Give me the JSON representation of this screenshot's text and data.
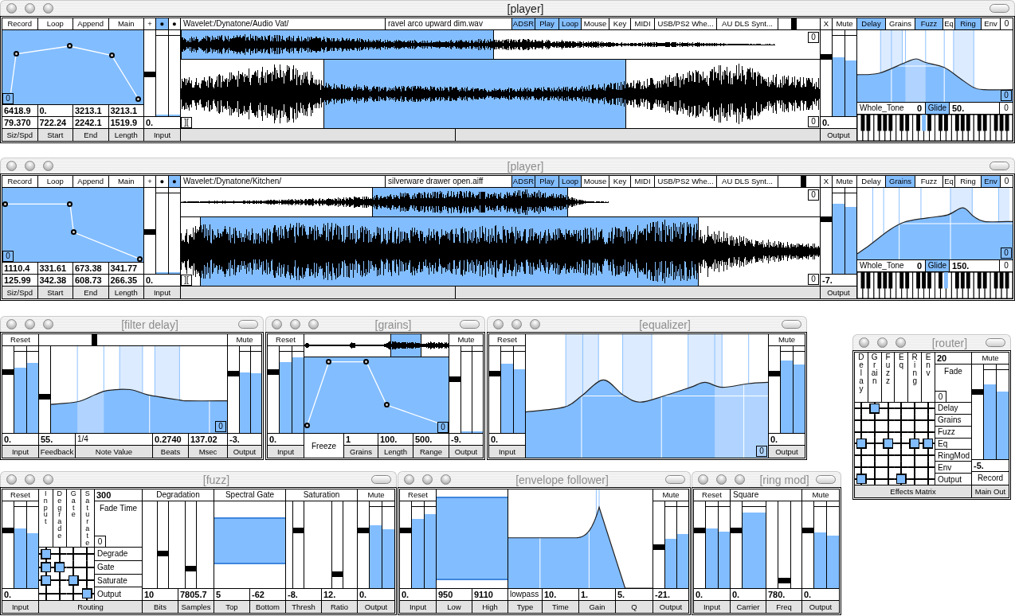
{
  "players": [
    {
      "title": "[player]",
      "active": true,
      "modes": [
        {
          "label": "Record"
        },
        {
          "label": "Loop"
        },
        {
          "label": "Append"
        },
        {
          "label": "Main"
        }
      ],
      "envelope": {
        "corner": "0"
      },
      "stats": {
        "rows": [
          [
            "6418.9",
            "0.",
            "3213.1",
            "3213.1"
          ],
          [
            "79.370",
            "722.24",
            "2242.1",
            "1519.9"
          ]
        ],
        "labels": [
          "Siz/Spd",
          "Start",
          "End",
          "Length"
        ]
      },
      "input": {
        "buttons": [
          {
            "label": "+",
            "on": false
          },
          {
            "label": "●",
            "on": true
          },
          {
            "label": "●",
            "on": false
          }
        ],
        "slider": {
          "level": 0.49
        },
        "meters": [
          {
            "level": 0.02
          },
          {
            "level": 0.02
          }
        ],
        "value": "0.",
        "label": "Input"
      },
      "path": "Wavelet:/Dynatone/Audio Vat/",
      "file": "ravel arco upward dim.wav",
      "sources": [
        {
          "label": "ADSR",
          "on": true
        },
        {
          "label": "Play",
          "on": true
        },
        {
          "label": "Loop",
          "on": true
        },
        {
          "label": "Mouse",
          "on": false
        },
        {
          "label": "Key",
          "on": false
        },
        {
          "label": "MIDI",
          "on": false
        },
        {
          "label": "USB/PS2 Whe...",
          "on": false
        },
        {
          "label": "AU DLS Synt...",
          "on": false
        }
      ],
      "source_slider": {
        "level": 0.35
      },
      "overview": {
        "corner": "0",
        "selection": [
          {
            "level": 0
          },
          {
            "level": 0.49
          }
        ]
      },
      "waveform": {
        "start_marker": "][",
        "corner": "0",
        "selection": [
          {
            "level": 0.224
          },
          {
            "level": 0.697
          }
        ]
      },
      "output": {
        "buttons": [
          {
            "label": "X"
          },
          {
            "label": "Mute"
          }
        ],
        "slider": {
          "level": 0.7
        },
        "meters": [
          {
            "level": 0.73
          },
          {
            "level": 0.69
          }
        ],
        "value": "0.",
        "label": "Output"
      },
      "effects": [
        {
          "label": "Delay",
          "on": true
        },
        {
          "label": "Grains",
          "on": false
        },
        {
          "label": "Fuzz",
          "on": true
        },
        {
          "label": "Eq",
          "on": false
        },
        {
          "label": "Ring",
          "on": true
        },
        {
          "label": "Env",
          "on": false
        }
      ],
      "effects_count": "0",
      "eq_graph": {
        "corner": "0"
      },
      "scale": {
        "name": "Whole_Tone",
        "value": "0"
      },
      "glide": {
        "label": "Glide",
        "on": true,
        "value": "50.",
        "extra": "0"
      }
    },
    {
      "title": "[player]",
      "active": false,
      "modes": [
        {
          "label": "Record"
        },
        {
          "label": "Loop"
        },
        {
          "label": "Append"
        },
        {
          "label": "Main"
        }
      ],
      "envelope": {
        "corner": "0"
      },
      "stats": {
        "rows": [
          [
            "1110.4",
            "331.61",
            "673.38",
            "341.77"
          ],
          [
            "125.99",
            "342.38",
            "608.73",
            "266.35"
          ]
        ],
        "labels": [
          "Siz/Spd",
          "Start",
          "End",
          "Length"
        ]
      },
      "input": {
        "buttons": [
          {
            "label": "+",
            "on": false
          },
          {
            "label": "●",
            "on": false
          },
          {
            "label": "●",
            "on": true
          }
        ],
        "slider": {
          "level": 0.49
        },
        "meters": [
          {
            "level": 0.02
          },
          {
            "level": 0.02
          }
        ],
        "value": "0.",
        "label": "Input"
      },
      "path": "Wavelet:/Dynatone/Kitchen/",
      "file": "silverware drawer open.aiff",
      "sources": [
        {
          "label": "ADSR",
          "on": true
        },
        {
          "label": "Play",
          "on": true
        },
        {
          "label": "Loop",
          "on": true
        },
        {
          "label": "Mouse",
          "on": false
        },
        {
          "label": "Key",
          "on": false
        },
        {
          "label": "MIDI",
          "on": false
        },
        {
          "label": "USB/PS2 Whe...",
          "on": false
        },
        {
          "label": "AU DLS Synt...",
          "on": false
        }
      ],
      "source_slider": {
        "level": 0.62
      },
      "overview": {
        "corner": "0",
        "selection": [
          {
            "level": 0.3
          },
          {
            "level": 0.606
          }
        ]
      },
      "waveform": {
        "start_marker": "][",
        "corner": "0",
        "selection": [
          {
            "level": 0.03
          },
          {
            "level": 0.81
          }
        ]
      },
      "output": {
        "buttons": [
          {
            "label": "X"
          },
          {
            "label": "Mute"
          }
        ],
        "slider": {
          "level": 0.64
        },
        "meters": [
          {
            "level": 0.87
          },
          {
            "level": 0.83
          }
        ],
        "value": "-7.",
        "label": "Output"
      },
      "effects": [
        {
          "label": "Delay",
          "on": false
        },
        {
          "label": "Grains",
          "on": true
        },
        {
          "label": "Fuzz",
          "on": false
        },
        {
          "label": "Eq",
          "on": false
        },
        {
          "label": "Ring",
          "on": false
        },
        {
          "label": "Env",
          "on": true
        }
      ],
      "effects_count": "0",
      "eq_graph": {
        "corner": "0"
      },
      "scale": {
        "name": "Whole_Tone",
        "value": "0"
      },
      "glide": {
        "label": "Glide",
        "on": true,
        "value": "150.",
        "extra": "0"
      }
    }
  ],
  "filter_delay": {
    "title": "[filter delay]",
    "active": false,
    "input": {
      "buttons": [
        {
          "label": "Reset"
        }
      ],
      "slider": {
        "level": 0.72
      },
      "meters": [
        {
          "level": 0.8
        },
        {
          "level": 0.86
        }
      ],
      "value": "0.",
      "label": "Input"
    },
    "note_slider": {
      "level": 0.29
    },
    "feedback_slider": {
      "level": 0.41
    },
    "graph": {
      "corner": "0"
    },
    "fields": [
      {
        "kind": "number",
        "value": "55.",
        "label": "Feedback"
      },
      {
        "kind": "menu",
        "value": "1/4",
        "label": "Note Value"
      },
      {
        "kind": "number",
        "value": "0.2740",
        "label": "Beats"
      },
      {
        "kind": "number",
        "value": "137.02",
        "label": "Msec"
      }
    ],
    "output": {
      "buttons": [
        {
          "label": "Mute"
        }
      ],
      "slider": {
        "level": 0.7
      },
      "meters": [
        {
          "level": 0.75
        },
        {
          "level": 0.74
        }
      ],
      "value": "-3.",
      "label": "Output"
    }
  },
  "grains": {
    "title": "[grains]",
    "active": false,
    "input": {
      "buttons": [
        {
          "label": "Reset"
        }
      ],
      "slider": {
        "level": 0.72
      },
      "meters": [
        {
          "level": 0.87
        },
        {
          "level": 0.93
        }
      ],
      "value": "0.",
      "label": "Input"
    },
    "overview": {
      "selection": [
        {
          "level": 0.6
        },
        {
          "level": 0.81
        }
      ]
    },
    "envelope": {
      "corner": "0"
    },
    "fields": [
      {
        "kind": "button",
        "label": "Freeze"
      },
      {
        "kind": "number",
        "value": "1",
        "label": "Grains"
      },
      {
        "kind": "number",
        "value": "100.",
        "label": "Length"
      },
      {
        "kind": "number",
        "value": "500.",
        "label": "Range"
      }
    ],
    "output": {
      "buttons": [
        {
          "label": "Mute"
        }
      ],
      "slider": {
        "level": 0.63
      },
      "meters": [
        {
          "level": 0.02
        },
        {
          "level": 0.02
        }
      ],
      "value": "-9.",
      "label": "Output"
    }
  },
  "equalizer": {
    "title": "[equalizer]",
    "active": false,
    "input": {
      "buttons": [
        {
          "label": "Reset"
        }
      ],
      "slider": {
        "level": 0.7
      },
      "meters": [
        {
          "level": 0.85
        },
        {
          "level": 0.78
        }
      ],
      "value": "0.",
      "label": "Input"
    },
    "graph": {
      "corner": "0"
    },
    "output": {
      "buttons": [
        {
          "label": "Mute"
        }
      ],
      "slider": {
        "level": 0.7
      },
      "meters": [
        {
          "level": 0.89
        },
        {
          "level": 0.84
        }
      ],
      "value": "0.",
      "label": "Output"
    }
  },
  "router": {
    "title": "[router]",
    "active": false,
    "columns": [
      "Delay",
      "Grain",
      "Fuzz",
      "Eq",
      "Ring",
      "Env"
    ],
    "fade": {
      "value": "20",
      "label": "Fade",
      "extra": "0"
    },
    "rows": [
      {
        "label": "Delay",
        "cells": [
          {
            "on": false
          },
          {
            "on": true
          },
          {
            "on": false
          },
          {
            "on": false
          },
          {
            "on": false
          },
          {
            "on": false
          }
        ]
      },
      {
        "label": "Grains",
        "cells": [
          {
            "on": false
          },
          {
            "on": false
          },
          {
            "on": false
          },
          {
            "on": false
          },
          {
            "on": false
          },
          {
            "on": false
          }
        ]
      },
      {
        "label": "Fuzz",
        "cells": [
          {
            "on": false
          },
          {
            "on": false
          },
          {
            "on": false
          },
          {
            "on": false
          },
          {
            "on": false
          },
          {
            "on": false
          }
        ]
      },
      {
        "label": "Eq",
        "cells": [
          {
            "on": true
          },
          {
            "on": false
          },
          {
            "on": true
          },
          {
            "on": false
          },
          {
            "on": true
          },
          {
            "on": true
          }
        ]
      },
      {
        "label": "RingMod",
        "cells": [
          {
            "on": false
          },
          {
            "on": false
          },
          {
            "on": false
          },
          {
            "on": false
          },
          {
            "on": false
          },
          {
            "on": false
          }
        ]
      },
      {
        "label": "Env",
        "cells": [
          {
            "on": false
          },
          {
            "on": false
          },
          {
            "on": false
          },
          {
            "on": false
          },
          {
            "on": false
          },
          {
            "on": false
          }
        ]
      },
      {
        "label": "Output",
        "cells": [
          {
            "on": true
          },
          {
            "on": false
          },
          {
            "on": false
          },
          {
            "on": true
          },
          {
            "on": false
          },
          {
            "on": false
          }
        ]
      }
    ],
    "footer": "Effects Matrix",
    "output": {
      "buttons": [
        {
          "label": "Mute"
        }
      ],
      "slider": {
        "level": 0.72
      },
      "meters": [
        {
          "level": 0.84
        },
        {
          "level": 0.76
        }
      ],
      "value": "-5.",
      "action": "Record",
      "label": "Main Out"
    }
  },
  "fuzz": {
    "title": "[fuzz]",
    "active": false,
    "input": {
      "buttons": [
        {
          "label": "Reset"
        }
      ],
      "slider": {
        "level": 0.68
      },
      "meters": [
        {
          "level": 0.74
        },
        {
          "level": 0.68
        }
      ],
      "value": "0.",
      "label": "Input"
    },
    "routing": {
      "columns": [
        "Input",
        "Degrade",
        "Gate",
        "Saturate"
      ],
      "fade": {
        "value": "300",
        "label": "Fade Time",
        "extra": "0"
      },
      "rows": [
        {
          "label": "Degrade",
          "cells": [
            {
              "on": true
            },
            {
              "on": false
            },
            {
              "on": false
            },
            {
              "on": false
            }
          ]
        },
        {
          "label": "Gate",
          "cells": [
            {
              "on": true
            },
            {
              "on": true
            },
            {
              "on": false
            },
            {
              "on": false
            }
          ]
        },
        {
          "label": "Saturate",
          "cells": [
            {
              "on": true
            },
            {
              "on": false
            },
            {
              "on": true
            },
            {
              "on": false
            }
          ]
        },
        {
          "label": "Output",
          "cells": [
            {
              "on": false
            },
            {
              "on": false
            },
            {
              "on": false
            },
            {
              "on": true
            }
          ]
        }
      ],
      "footer": "Routing"
    },
    "degradation": {
      "title": "Degradation",
      "sliders": [
        {
          "level": 0.39
        },
        {
          "level": 0.21
        }
      ],
      "fields": [
        {
          "value": "10",
          "label": "Bits"
        },
        {
          "value": "7805.7",
          "label": "Samples"
        }
      ]
    },
    "spectral_gate": {
      "title": "Spectral Gate",
      "range": [
        {
          "level": 0.81
        },
        {
          "level": 0.28
        }
      ],
      "fields": [
        {
          "value": "5",
          "label": "Top"
        },
        {
          "value": "-62",
          "label": "Bottom"
        }
      ]
    },
    "saturation": {
      "title": "Saturation",
      "sliders": [
        {
          "level": 0.68
        },
        {
          "level": 0.14
        }
      ],
      "fields": [
        {
          "value": "-8.",
          "label": "Thresh"
        },
        {
          "value": "12.",
          "label": "Ratio"
        }
      ]
    },
    "output": {
      "buttons": [
        {
          "label": "Mute"
        }
      ],
      "slider": {
        "level": 0.68
      },
      "meters": [
        {
          "level": 0.77
        },
        {
          "level": 0.73
        }
      ],
      "value": "0.",
      "label": "Output"
    }
  },
  "envelope_follower": {
    "title": "[envelope follower]",
    "active": false,
    "input": {
      "buttons": [
        {
          "label": "Reset"
        }
      ],
      "slider": {
        "level": 0.68
      },
      "meters": [
        {
          "level": 0.85
        },
        {
          "level": 0.91
        }
      ],
      "value": "0.",
      "label": "Input"
    },
    "band": {
      "range": [
        {
          "level": 0.93
        },
        {
          "level": 0.08
        }
      ],
      "fields": [
        {
          "value": "950",
          "label": "Low"
        },
        {
          "value": "9110",
          "label": "High"
        }
      ]
    },
    "fields": [
      {
        "kind": "menu",
        "value": "lowpass",
        "label": "Type"
      },
      {
        "kind": "number",
        "value": "10.",
        "label": "Time"
      },
      {
        "kind": "number",
        "value": "1.",
        "label": "Gain"
      },
      {
        "kind": "number",
        "value": "5.",
        "label": "Q"
      }
    ],
    "output": {
      "buttons": [
        {
          "label": "Mute"
        }
      ],
      "slider": {
        "level": 0.47
      },
      "meters": [
        {
          "level": 0.61
        },
        {
          "level": 0.67
        }
      ],
      "value": "-21.",
      "label": "Output"
    }
  },
  "ring_mod": {
    "title": "[ring mod]",
    "active": false,
    "input": {
      "buttons": [
        {
          "label": "Reset"
        }
      ],
      "slider": {
        "level": 0.68
      },
      "meters": [
        {
          "level": 0.74
        },
        {
          "level": 0.7
        }
      ],
      "value": "0.",
      "label": "Input"
    },
    "waveform": "Square",
    "carrier": {
      "slider": {
        "level": 0.68
      },
      "meter": {
        "level": 0.93
      }
    },
    "freq": {
      "slider": {
        "level": 0.06
      }
    },
    "fields": [
      {
        "value": "0.",
        "label": "Carrier"
      },
      {
        "value": "780.",
        "label": "Freq"
      }
    ],
    "output": {
      "buttons": [
        {
          "label": "Mute"
        }
      ],
      "slider": {
        "level": 0.68
      },
      "meters": [
        {
          "level": 0.69
        },
        {
          "level": 0.65
        }
      ],
      "value": "0.",
      "label": "Output"
    }
  }
}
